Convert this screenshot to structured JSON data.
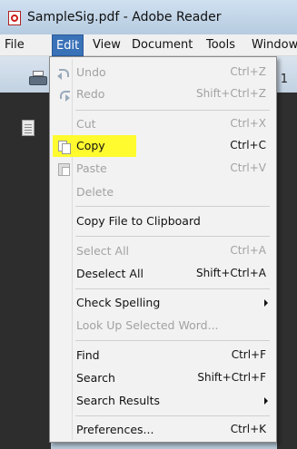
{
  "window": {
    "title": "SampleSig.pdf - Adobe Reader"
  },
  "menubar": {
    "items": [
      {
        "label": "File"
      },
      {
        "label": "Edit",
        "active": true
      },
      {
        "label": "View"
      },
      {
        "label": "Document"
      },
      {
        "label": "Tools"
      },
      {
        "label": "Window"
      }
    ]
  },
  "toolbar": {
    "right_text": "1"
  },
  "edit_menu": {
    "items": [
      {
        "label": "Undo",
        "shortcut": "Ctrl+Z",
        "enabled": false,
        "icon": "undo-icon"
      },
      {
        "label": "Redo",
        "shortcut": "Shift+Ctrl+Z",
        "enabled": false,
        "icon": "redo-icon"
      },
      {
        "label": "Cut",
        "shortcut": "Ctrl+X",
        "enabled": false
      },
      {
        "label": "Copy",
        "shortcut": "Ctrl+C",
        "enabled": true,
        "icon": "copy-icon",
        "highlighted": true
      },
      {
        "label": "Paste",
        "shortcut": "Ctrl+V",
        "enabled": false,
        "icon": "paste-icon"
      },
      {
        "label": "Delete",
        "shortcut": "",
        "enabled": false
      },
      {
        "label": "Copy File to Clipboard",
        "shortcut": "",
        "enabled": true
      },
      {
        "label": "Select All",
        "shortcut": "Ctrl+A",
        "enabled": false
      },
      {
        "label": "Deselect All",
        "shortcut": "Shift+Ctrl+A",
        "enabled": true
      },
      {
        "label": "Check Spelling",
        "shortcut": "",
        "enabled": true,
        "submenu": true
      },
      {
        "label": "Look Up Selected Word...",
        "shortcut": "",
        "enabled": false
      },
      {
        "label": "Find",
        "shortcut": "Ctrl+F",
        "enabled": true
      },
      {
        "label": "Search",
        "shortcut": "Shift+Ctrl+F",
        "enabled": true
      },
      {
        "label": "Search Results",
        "shortcut": "",
        "enabled": true,
        "submenu": true
      },
      {
        "label": "Preferences...",
        "shortcut": "Ctrl+K",
        "enabled": true
      }
    ]
  },
  "colors": {
    "highlight": "#fffb2e",
    "menu_active": "#3a72b8",
    "disabled_text": "#a2a2a2"
  }
}
